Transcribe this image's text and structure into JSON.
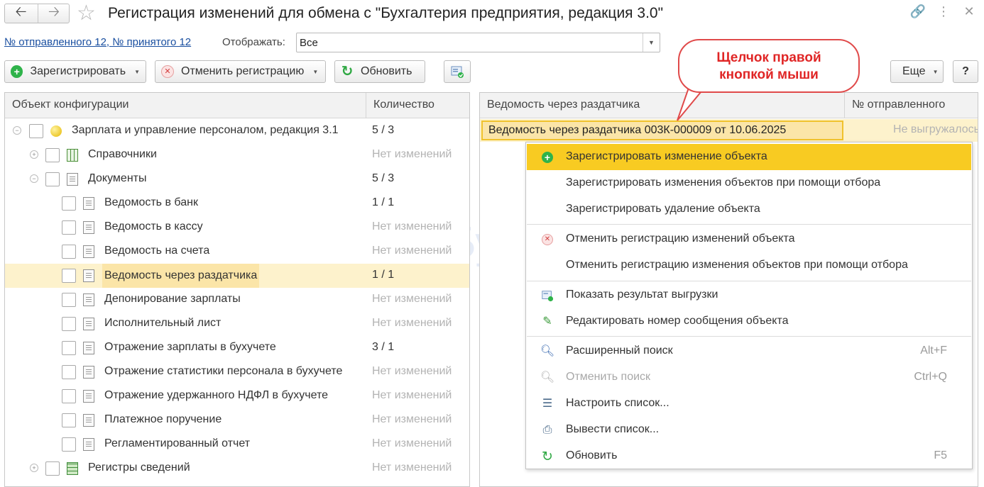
{
  "window": {
    "title": "Регистрация изменений для обмена с  \"Бухгалтерия предприятия, редакция 3.0\""
  },
  "filter": {
    "link": "№ отправленного 12, № принятого 12",
    "label": "Отображать:",
    "value": "Все"
  },
  "toolbar": {
    "register": "Зарегистрировать",
    "cancel": "Отменить регистрацию",
    "refresh": "Обновить",
    "more": "Еще",
    "help": "?"
  },
  "callout": {
    "line1": "Щелчок правой",
    "line2": "кнопкой мыши"
  },
  "left": {
    "col_object": "Объект конфигурации",
    "col_count": "Количество",
    "rows": [
      {
        "label": "Зарплата и управление персоналом, редакция 3.1",
        "count": "5 / 3"
      },
      {
        "label": "Справочники",
        "count": "Нет изменений"
      },
      {
        "label": "Документы",
        "count": "5 / 3"
      },
      {
        "label": "Ведомость в банк",
        "count": "1 / 1"
      },
      {
        "label": "Ведомость в кассу",
        "count": "Нет изменений"
      },
      {
        "label": "Ведомость на счета",
        "count": "Нет изменений"
      },
      {
        "label": "Ведомость через раздатчика",
        "count": "1 / 1"
      },
      {
        "label": "Депонирование зарплаты",
        "count": "Нет изменений"
      },
      {
        "label": "Исполнительный лист",
        "count": "Нет изменений"
      },
      {
        "label": "Отражение зарплаты в бухучете",
        "count": "3 / 1"
      },
      {
        "label": "Отражение статистики персонала в бухучете",
        "count": "Нет изменений"
      },
      {
        "label": "Отражение удержанного НДФЛ в бухучете",
        "count": "Нет изменений"
      },
      {
        "label": "Платежное поручение",
        "count": "Нет изменений"
      },
      {
        "label": "Регламентированный отчет",
        "count": "Нет изменений"
      },
      {
        "label": "Регистры сведений",
        "count": "Нет изменений"
      }
    ]
  },
  "right": {
    "col_object": "Ведомость через раздатчика",
    "col_num": "№ отправленного",
    "row_object": "Ведомость через раздатчика 003К-000009 от 10.06.2025",
    "row_num": "Не выгружалось"
  },
  "menu": {
    "items": [
      {
        "label": "Зарегистрировать изменение объекта",
        "key": ""
      },
      {
        "label": "Зарегистрировать изменения объектов при помощи отбора",
        "key": ""
      },
      {
        "label": "Зарегистрировать удаление объекта",
        "key": ""
      },
      {
        "label": "Отменить регистрацию изменений объекта",
        "key": ""
      },
      {
        "label": "Отменить регистрацию изменения объектов при помощи отбора",
        "key": ""
      },
      {
        "label": "Показать результат выгрузки",
        "key": ""
      },
      {
        "label": "Редактировать номер сообщения объекта",
        "key": ""
      },
      {
        "label": "Расширенный поиск",
        "key": "Alt+F"
      },
      {
        "label": "Отменить поиск",
        "key": "Ctrl+Q"
      },
      {
        "label": "Настроить список...",
        "key": ""
      },
      {
        "label": "Вывести список...",
        "key": ""
      },
      {
        "label": "Обновить",
        "key": "F5"
      }
    ]
  },
  "watermark": "БухЭксперт",
  "colors": {
    "accent": "#f8cb22",
    "selection": "#fdf2cc",
    "link": "#1a4fa0",
    "callout": "#e02626"
  }
}
